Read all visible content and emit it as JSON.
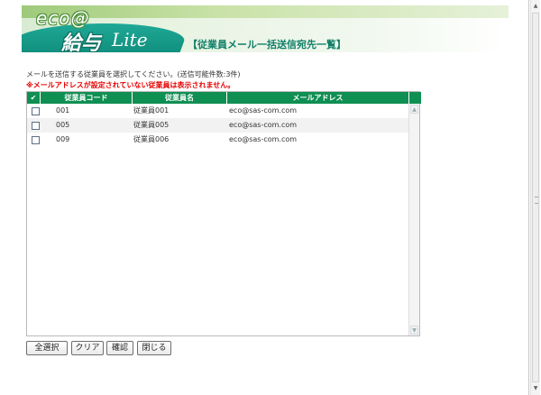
{
  "header": {
    "logo_eco": "eco@",
    "logo_kyuyo": "給与",
    "logo_lite": "Lite",
    "title": "【従業員メール一括送信宛先一覧】"
  },
  "instructions": {
    "select_text": "メールを送信する従業員を選択してください。(送信可能件数:3件)",
    "warning_text": "※メールアドレスが設定されていない従業員は表示されません。"
  },
  "table": {
    "header_check": "✔",
    "columns": [
      "従業員コード",
      "従業員名",
      "メールアドレス"
    ],
    "rows": [
      {
        "code": "001",
        "name": "従業員001",
        "email": "eco@sas-com.com"
      },
      {
        "code": "005",
        "name": "従業員005",
        "email": "eco@sas-com.com"
      },
      {
        "code": "009",
        "name": "従業員006",
        "email": "eco@sas-com.com"
      }
    ]
  },
  "buttons": {
    "select_all": "全選択",
    "clear": "クリア",
    "confirm": "確認",
    "close": "閉じる"
  },
  "icons": {
    "scroll_up": "chevron-up-icon",
    "scroll_down": "chevron-down-icon"
  },
  "colors": {
    "header_green": "#0f8f52",
    "warning_red": "#e60000",
    "title_green": "#0f7f68"
  }
}
